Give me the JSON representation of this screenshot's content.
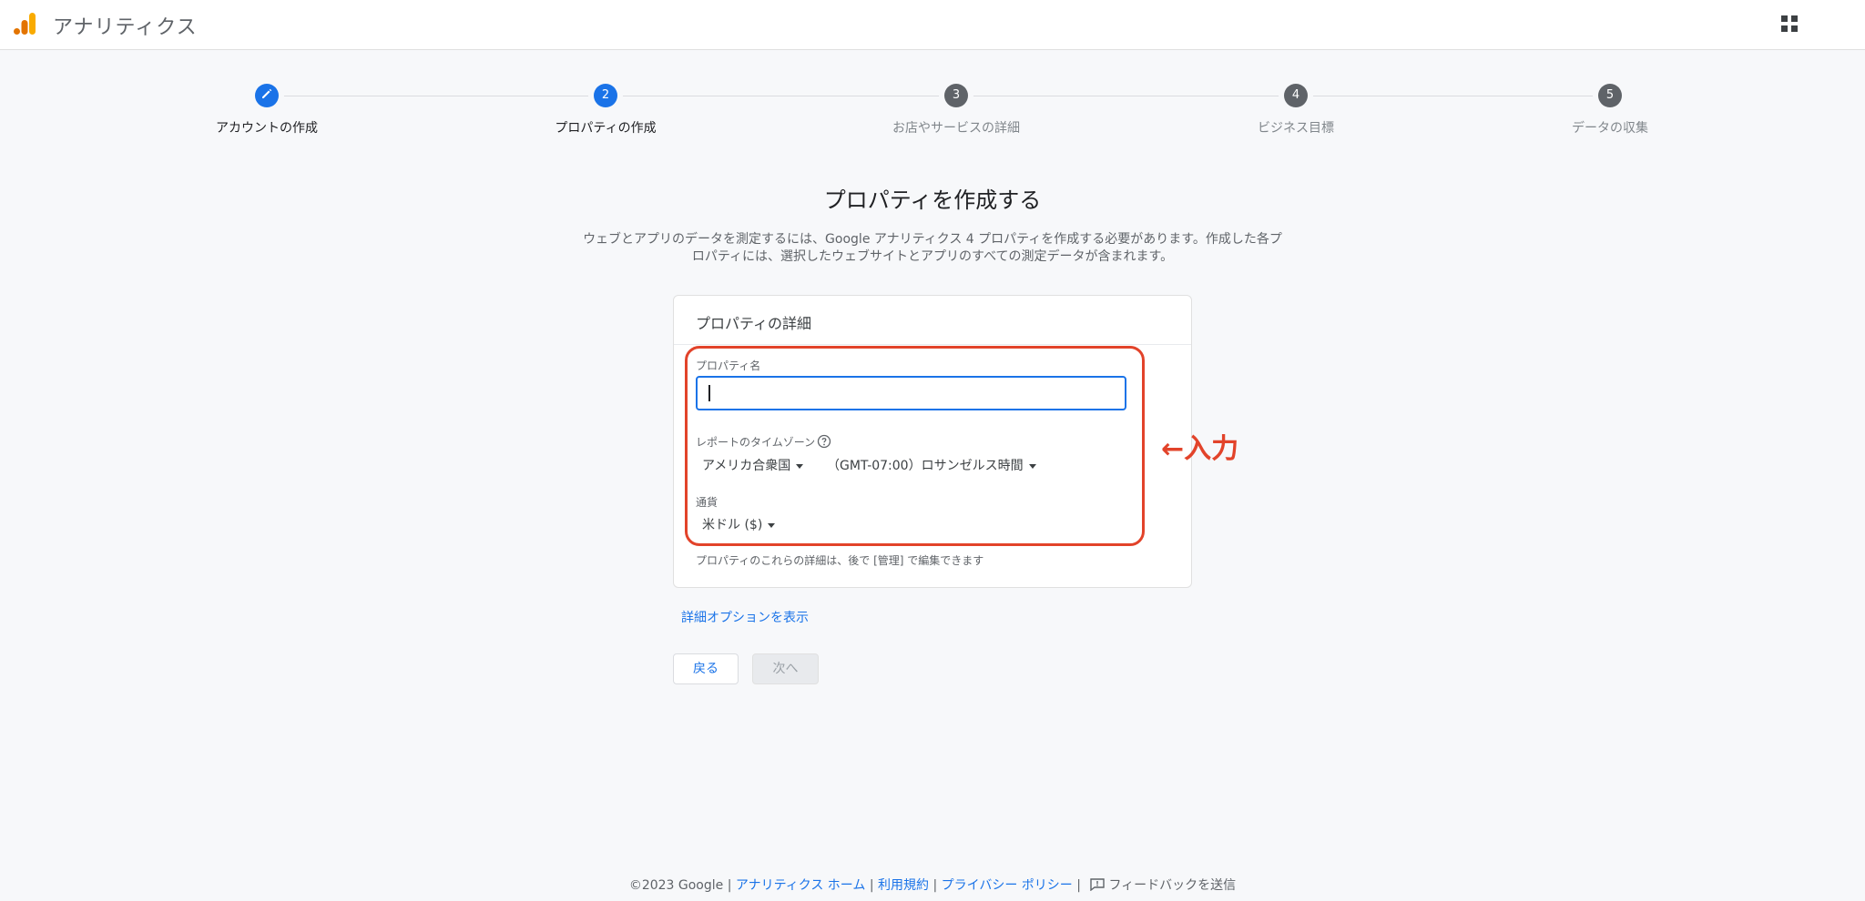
{
  "header": {
    "app_title": "アナリティクス",
    "logo_icon": "analytics-logo-icon",
    "apps_icon": "apps-grid-icon"
  },
  "stepper": {
    "steps": [
      {
        "number": "",
        "label": "アカウントの作成",
        "state": "done",
        "icon": "pencil-icon"
      },
      {
        "number": "2",
        "label": "プロパティの作成",
        "state": "active"
      },
      {
        "number": "3",
        "label": "お店やサービスの詳細",
        "state": "inactive"
      },
      {
        "number": "4",
        "label": "ビジネス目標",
        "state": "inactive"
      },
      {
        "number": "5",
        "label": "データの収集",
        "state": "inactive"
      }
    ]
  },
  "main": {
    "title": "プロパティを作成する",
    "description": "ウェブとアプリのデータを測定するには、Google アナリティクス 4 プロパティを作成する必要があります。作成した各プロパティには、選択したウェブサイトとアプリのすべての測定データが含まれます。"
  },
  "card": {
    "header": "プロパティの詳細",
    "property_name_label": "プロパティ名",
    "property_name_value": "",
    "timezone_label": "レポートのタイムゾーン",
    "country_value": "アメリカ合衆国",
    "timezone_value": "（GMT-07:00）ロサンゼルス時間",
    "currency_label": "通貨",
    "currency_value": "米ドル ($)",
    "note": "プロパティのこれらの詳細は、後で [管理] で編集できます"
  },
  "annotation": {
    "text": "←入力",
    "color": "#e2432a"
  },
  "actions": {
    "advanced_link": "詳細オプションを表示",
    "back_label": "戻る",
    "next_label": "次へ"
  },
  "footer": {
    "copyright": "©2023 Google",
    "sep": " | ",
    "home_link": "アナリティクス ホーム",
    "terms_link": "利用規約",
    "privacy_link": "プライバシー ポリシー",
    "feedback": "フィードバックを送信"
  },
  "colors": {
    "accent": "#1a73e8",
    "annotation": "#e2432a",
    "logo_orange": "#f9ab00",
    "logo_dark_orange": "#e37400"
  }
}
